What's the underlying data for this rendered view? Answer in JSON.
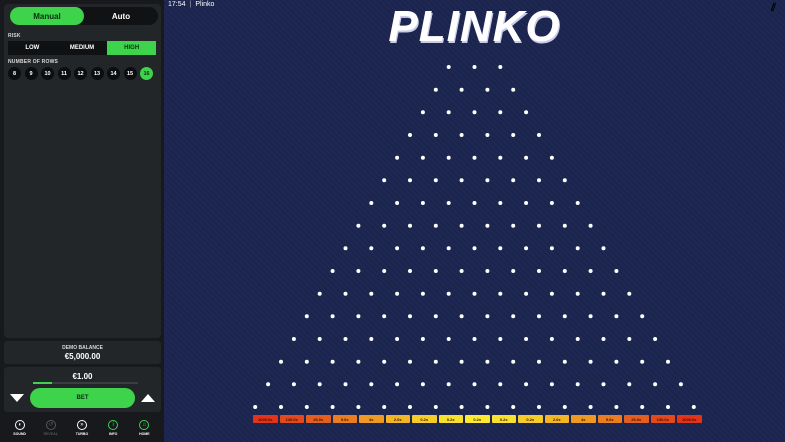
{
  "sidebar": {
    "mode_tabs": [
      {
        "label": "Manual",
        "active": true
      },
      {
        "label": "Auto",
        "active": false
      }
    ],
    "risk_label": "RISK",
    "risk_options": [
      {
        "label": "LOW",
        "active": false
      },
      {
        "label": "MEDIUM",
        "active": false
      },
      {
        "label": "HIGH",
        "active": true
      }
    ],
    "rows_label": "NUMBER OF ROWS",
    "row_options": [
      {
        "label": "8",
        "active": false
      },
      {
        "label": "9",
        "active": false
      },
      {
        "label": "10",
        "active": false
      },
      {
        "label": "11",
        "active": false
      },
      {
        "label": "12",
        "active": false
      },
      {
        "label": "13",
        "active": false
      },
      {
        "label": "14",
        "active": false
      },
      {
        "label": "15",
        "active": false
      },
      {
        "label": "16",
        "active": true
      }
    ],
    "balance_label": "DEMO BALANCE",
    "balance_value": "€5,000.00",
    "bet_amount": "€1.00",
    "bet_slider_fraction": 0.18,
    "bet_label": "BET",
    "nav": [
      {
        "label": "SOUND",
        "icon": "sound-icon",
        "glyph": "◖",
        "enabled": true
      },
      {
        "label": "REVEAL",
        "icon": "reveal-icon",
        "glyph": "↺",
        "enabled": false
      },
      {
        "label": "TURBO",
        "icon": "turbo-icon",
        "glyph": "»",
        "enabled": true
      },
      {
        "label": "INFO",
        "icon": "info-icon",
        "glyph": "i",
        "enabled": true
      },
      {
        "label": "HOME",
        "icon": "home-icon",
        "glyph": "⌂",
        "enabled": true
      }
    ]
  },
  "game": {
    "time": "17:54",
    "title": "Plinko",
    "logo": "PLINKO",
    "rows": 16,
    "multipliers": [
      {
        "label": "1000.0x",
        "color": "#e3341a"
      },
      {
        "label": "130.0x",
        "color": "#e4481b"
      },
      {
        "label": "26.0x",
        "color": "#e65e1d"
      },
      {
        "label": "9.0x",
        "color": "#ea7d1f"
      },
      {
        "label": "4x",
        "color": "#ee9a22"
      },
      {
        "label": "2.0x",
        "color": "#f2b526"
      },
      {
        "label": "0.2x",
        "color": "#f5cd2a"
      },
      {
        "label": "0.2x",
        "color": "#f8e02e"
      },
      {
        "label": "0.2x",
        "color": "#fbea31"
      },
      {
        "label": "0.2x",
        "color": "#f8e02e"
      },
      {
        "label": "0.2x",
        "color": "#f5cd2a"
      },
      {
        "label": "2.0x",
        "color": "#f2b526"
      },
      {
        "label": "4x",
        "color": "#ee9a22"
      },
      {
        "label": "9.0x",
        "color": "#ea7d1f"
      },
      {
        "label": "26.0x",
        "color": "#e65e1d"
      },
      {
        "label": "130.0x",
        "color": "#e4481b"
      },
      {
        "label": "1000.0x",
        "color": "#e3341a"
      }
    ]
  },
  "colors": {
    "accent": "#3dd34b",
    "background": "#1d2752",
    "sidebar": "#232629"
  }
}
